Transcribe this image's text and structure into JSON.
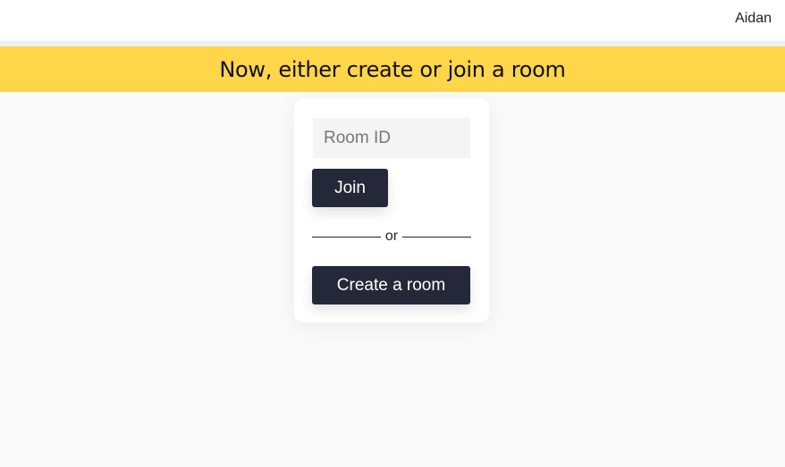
{
  "header": {
    "username": "Aidan"
  },
  "banner": {
    "title": "Now, either create or join a room"
  },
  "card": {
    "room_input": {
      "placeholder": "Room ID",
      "value": ""
    },
    "join_label": "Join",
    "divider_text": "or",
    "create_label": "Create a room"
  },
  "colors": {
    "banner": "#ffd54a",
    "button": "#252838",
    "background": "#fafafa"
  }
}
